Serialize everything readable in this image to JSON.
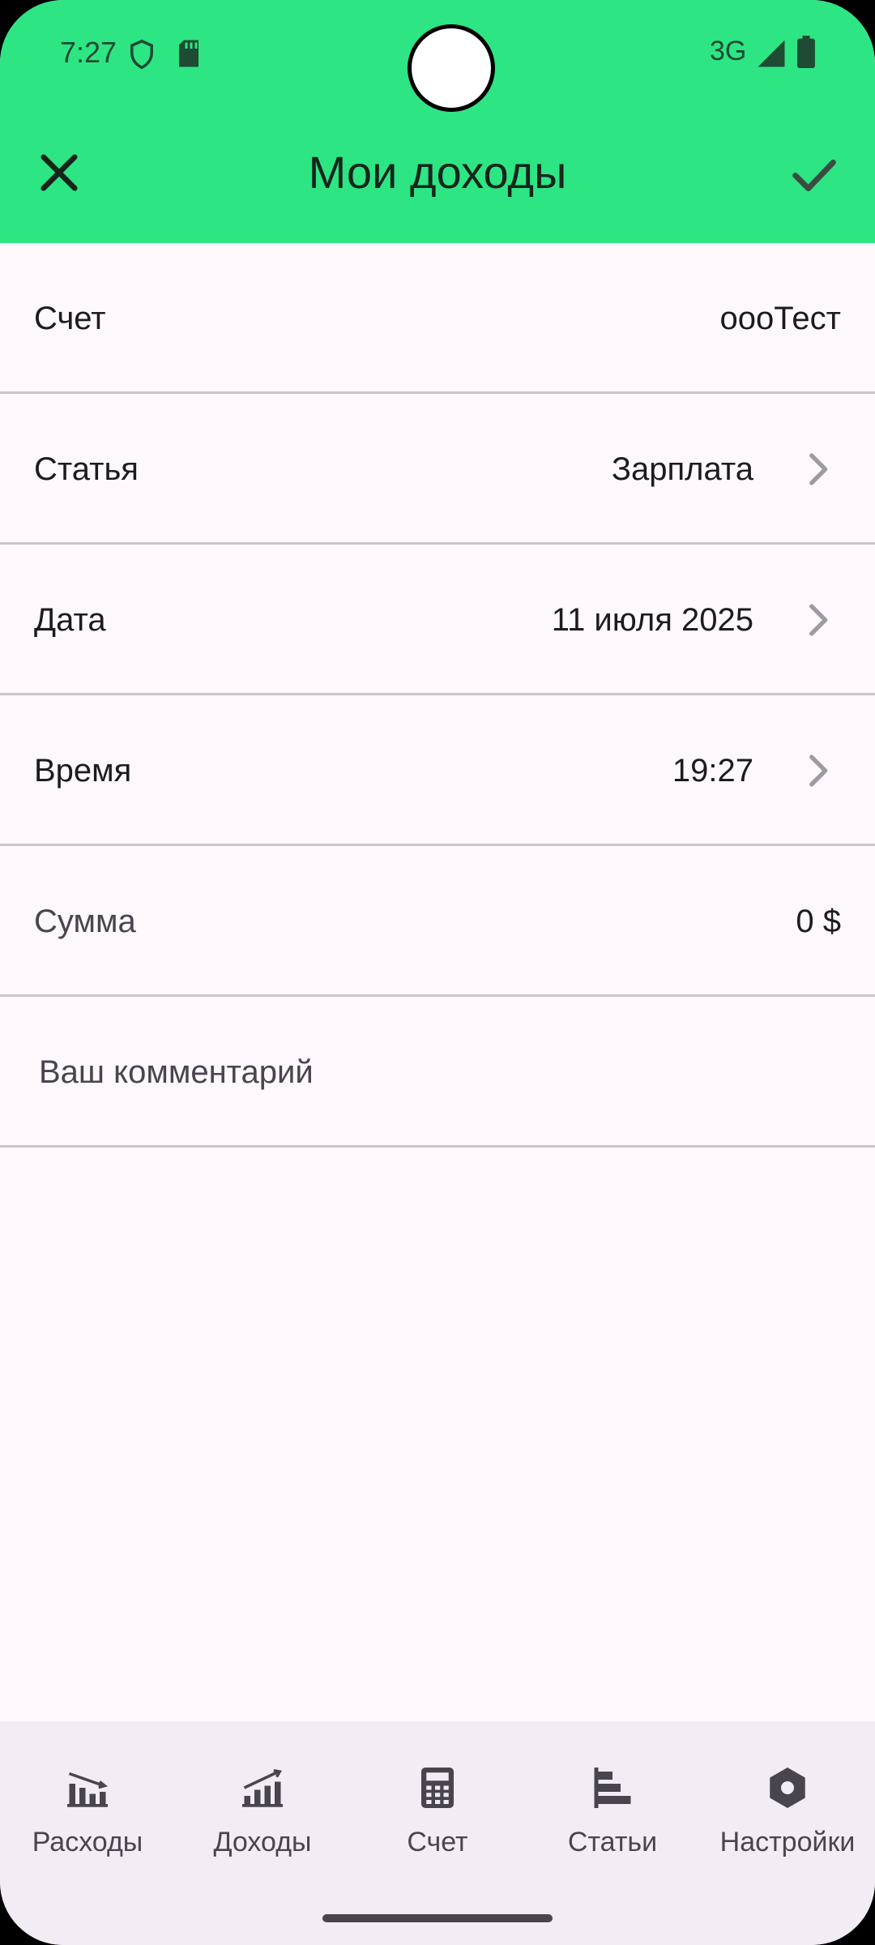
{
  "status_bar": {
    "time": "7:27",
    "network": "3G"
  },
  "header": {
    "title": "Мои доходы",
    "bg_color": "#2EE584",
    "left_icon": "close-icon",
    "right_icon": "check-icon"
  },
  "form": {
    "account": {
      "label": "Счет",
      "value": "оооТест"
    },
    "category": {
      "label": "Статья",
      "value": "Зарплата"
    },
    "date": {
      "label": "Дата",
      "value": "11 июля 2025"
    },
    "time": {
      "label": "Время",
      "value": "19:27"
    },
    "amount": {
      "label": "Сумма",
      "value": "0 $"
    },
    "comment": {
      "placeholder": "Ваш комментарий"
    }
  },
  "bottom_nav": {
    "items": [
      {
        "label": "Расходы",
        "icon": "expenses-chart-icon"
      },
      {
        "label": "Доходы",
        "icon": "income-chart-icon"
      },
      {
        "label": "Счет",
        "icon": "calculator-icon"
      },
      {
        "label": "Статьи",
        "icon": "articles-bars-icon"
      },
      {
        "label": "Настройки",
        "icon": "settings-hexagon-icon"
      }
    ]
  }
}
